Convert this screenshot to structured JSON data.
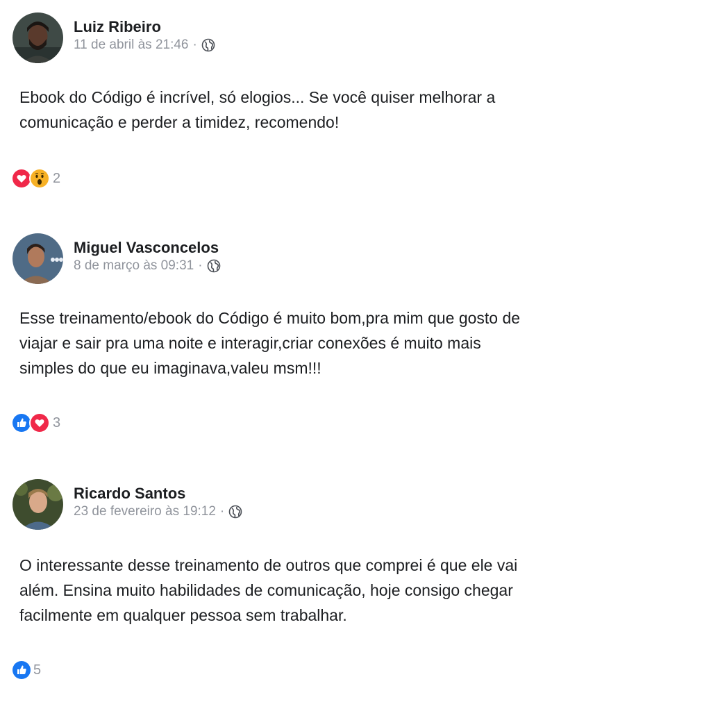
{
  "posts": [
    {
      "author": "Luiz Ribeiro",
      "date": "11 de abril às 21:46",
      "separator": "·",
      "privacy_icon": "globe-icon",
      "lines": [
        "Ebook do Código é incrível, só elogios... Se você quiser melhorar a",
        "comunicação e perder a timidez, recomendo!"
      ],
      "reactions": [
        "love-icon",
        "wow-icon"
      ],
      "reaction_count": "2"
    },
    {
      "author": "Miguel Vasconcelos",
      "date": "8 de março às 09:31",
      "separator": "·",
      "privacy_icon": "globe-icon",
      "lines": [
        "Esse treinamento/ebook do Código é muito bom,pra mim que gosto de",
        "viajar e sair pra uma noite e interagir,criar conexões é muito mais",
        "simples do que eu imaginava,valeu msm!!!"
      ],
      "reactions": [
        "like-icon",
        "love-icon"
      ],
      "reaction_count": "3"
    },
    {
      "author": "Ricardo Santos",
      "date": "23 de fevereiro às 19:12",
      "separator": "·",
      "privacy_icon": "globe-icon",
      "lines": [
        "O interessante desse treinamento de outros que comprei é que ele vai",
        "além. Ensina muito habilidades de comunicação, hoje consigo chegar",
        "facilmente em qualquer pessoa sem trabalhar."
      ],
      "reactions": [
        "like-icon"
      ],
      "reaction_count": "5"
    }
  ],
  "colors": {
    "text": "#1c1e21",
    "meta": "#90949c",
    "like_blue": "#1877f2",
    "love_red": "#f02849",
    "wow_yellow": "#f7b125"
  }
}
